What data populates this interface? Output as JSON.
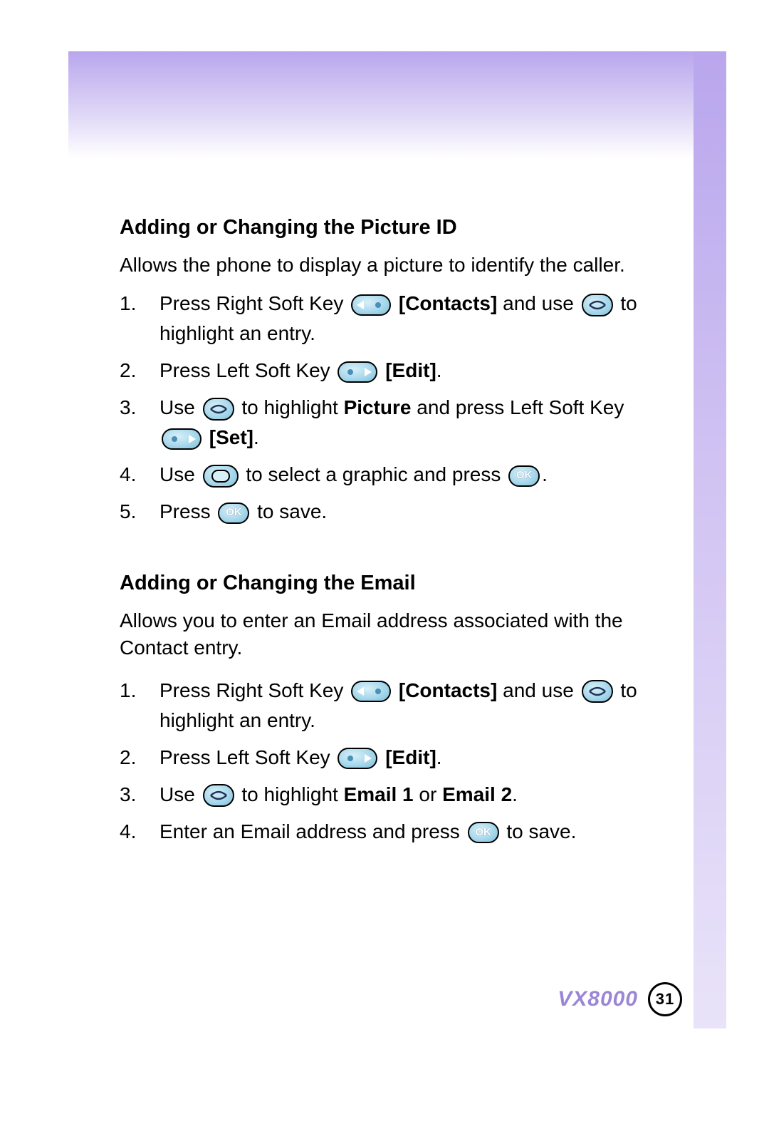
{
  "section1": {
    "heading": "Adding or Changing the Picture ID",
    "intro": "Allows the phone to display a picture to identify the caller.",
    "steps": {
      "n1": "1.",
      "s1a": "Press Right Soft Key ",
      "s1_contacts": "[Contacts]",
      "s1b": " and use ",
      "s1c": " to highlight an entry.",
      "n2": "2.",
      "s2a": "Press Left Soft Key ",
      "s2_edit": "[Edit]",
      "s2b": ".",
      "n3": "3.",
      "s3a": "Use ",
      "s3b": " to highlight ",
      "s3_picture": "Picture",
      "s3c": " and press Left Soft Key ",
      "s3_set": "[Set]",
      "s3d": ".",
      "n4": "4.",
      "s4a": "Use ",
      "s4b": " to select a graphic and press ",
      "s4c": ".",
      "n5": "5.",
      "s5a": "Press ",
      "s5b": " to save."
    }
  },
  "section2": {
    "heading": "Adding or Changing the Email",
    "intro": "Allows you to enter an Email address associated with the Contact entry.",
    "steps": {
      "n1": "1.",
      "s1a": "Press Right Soft Key ",
      "s1_contacts": "[Contacts]",
      "s1b": " and use ",
      "s1c": " to highlight an entry.",
      "n2": "2.",
      "s2a": "Press Left Soft Key ",
      "s2_edit": "[Edit]",
      "s2b": ".",
      "n3": "3.",
      "s3a": "Use ",
      "s3b": " to highlight ",
      "s3_email1": "Email 1",
      "s3_or": " or ",
      "s3_email2": "Email 2",
      "s3c": ".",
      "n4": "4.",
      "s4a": "Enter an Email address and press ",
      "s4b": " to save."
    }
  },
  "ok_label": "OK",
  "footer": {
    "model": "VX8000",
    "page": "31"
  }
}
